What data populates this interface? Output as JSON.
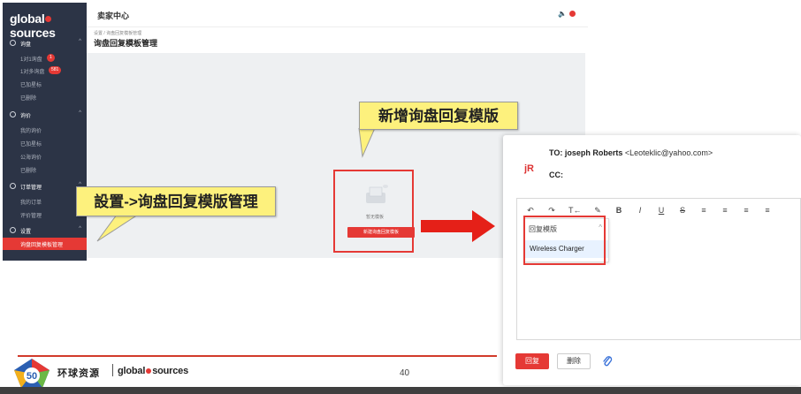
{
  "brand": {
    "prefix": "global",
    "suffix": "sources"
  },
  "sidebar": {
    "sections": [
      {
        "label": "询盘",
        "items": [
          {
            "label": "1对1询盘",
            "badge": "1"
          },
          {
            "label": "1对多询盘",
            "badge": "581"
          },
          {
            "label": "已加星标"
          },
          {
            "label": "已删除"
          }
        ]
      },
      {
        "label": "询价",
        "items": [
          {
            "label": "我的询价"
          },
          {
            "label": "已加星标"
          },
          {
            "label": "公海询价"
          },
          {
            "label": "已删除"
          }
        ]
      },
      {
        "label": "订单管理",
        "items": [
          {
            "label": "我的订单"
          },
          {
            "label": "评价管理"
          }
        ]
      },
      {
        "label": "设置",
        "items": [
          {
            "label": "询盘回复模板管理",
            "active": true
          }
        ]
      }
    ]
  },
  "header": {
    "title": "卖家中心"
  },
  "breadcrumb": "设置 / 询盘回复模板管理",
  "page_title": "询盘回复模板管理",
  "empty_state": {
    "text": "暂无模板",
    "button": "新建询盘回复模板"
  },
  "callouts": {
    "new_template": "新增询盘回复模版",
    "nav_path": "設置->询盘回复模版管理"
  },
  "mail": {
    "to_label": "TO:",
    "to_name": "joseph Roberts",
    "to_email": "<Leoteklic@yahoo.com>",
    "avatar": "jR",
    "cc_label": "CC:",
    "dropdown_title": "回复模版",
    "dropdown_option": "Wireless Charger",
    "reply_button": "回复",
    "delete_button": "删除"
  },
  "footer": {
    "brand_cn": "环球资源",
    "brand_prefix": "global",
    "brand_suffix": "sources",
    "page_number": "40"
  },
  "colors": {
    "accent": "#e53935",
    "sidebar": "#2c3446",
    "callout": "#fdf17d"
  }
}
